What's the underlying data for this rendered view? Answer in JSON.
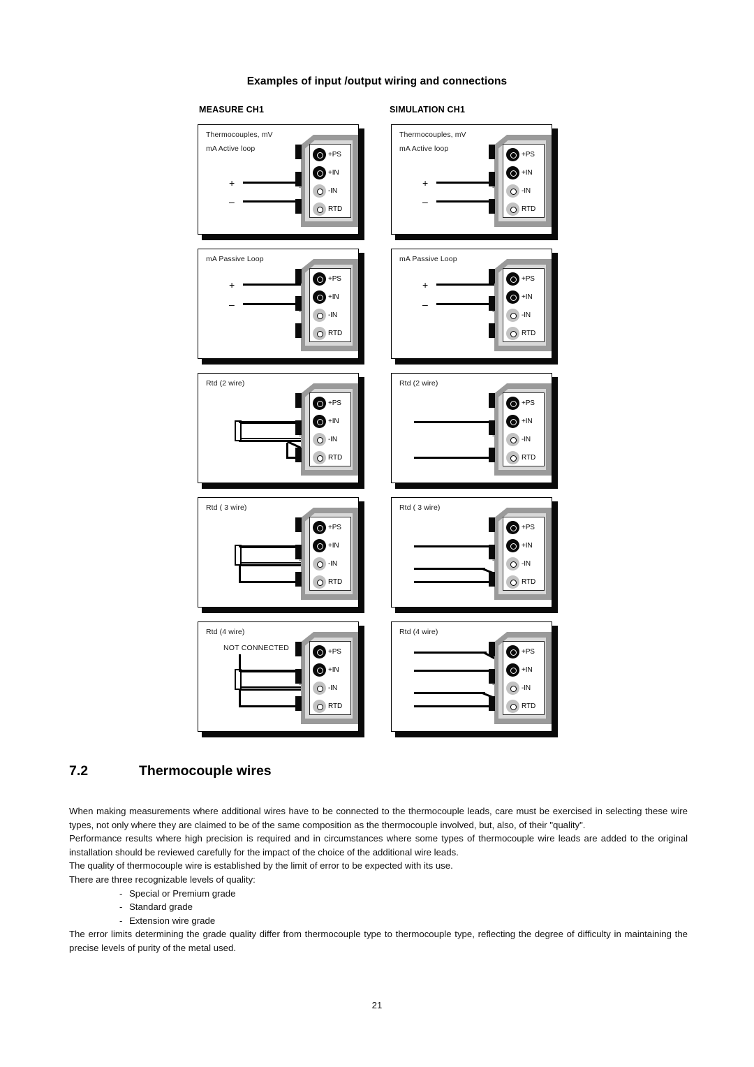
{
  "figure": {
    "title": "Examples of input /output wiring and connections",
    "columns": [
      {
        "id": "measure",
        "header": "MEASURE CH1"
      },
      {
        "id": "simulation",
        "header": "SIMULATION CH1"
      }
    ],
    "terminal_labels": [
      "+PS",
      "+IN",
      "-IN",
      "RTD"
    ],
    "terminal_states": [
      "dark",
      "dark",
      "light",
      "light"
    ],
    "dash_mark": "-",
    "rows": [
      {
        "caption_line1": "Thermocouples, mV",
        "caption_line2": "mA Active loop",
        "measure": {
          "caption_line1": "Thermocouples, mV",
          "caption_line2": "mA Active loop",
          "plus_sign": "+",
          "minus_sign": "–",
          "connected_terminals": [
            "+IN",
            "-IN"
          ],
          "not_connected_label": ""
        },
        "simulation": {
          "caption_line1": "Thermocouples, mV",
          "caption_line2": "mA Active loop",
          "plus_sign": "+",
          "minus_sign": "–",
          "connected_terminals": [
            "+IN",
            "-IN"
          ],
          "not_connected_label": ""
        }
      },
      {
        "caption_line1": "mA Passive Loop",
        "caption_line2": "",
        "measure": {
          "caption_line1": "mA Passive Loop",
          "caption_line2": "",
          "plus_sign": "+",
          "minus_sign": "–",
          "connected_terminals": [
            "+PS",
            "+IN"
          ],
          "not_connected_label": ""
        },
        "simulation": {
          "caption_line1": "mA Passive Loop",
          "caption_line2": "",
          "plus_sign": "+",
          "minus_sign": "–",
          "connected_terminals": [
            "+PS",
            "+IN"
          ],
          "not_connected_label": ""
        }
      },
      {
        "caption_line1": "Rtd (2 wire)",
        "caption_line2": "",
        "measure": {
          "caption_line1": "Rtd (2 wire)",
          "caption_line2": "",
          "plus_sign": "",
          "minus_sign": "",
          "connected_terminals": [
            "+IN",
            "-IN",
            "RTD"
          ],
          "not_connected_label": ""
        },
        "simulation": {
          "caption_line1": "Rtd (2 wire)",
          "caption_line2": "",
          "plus_sign": "",
          "minus_sign": "",
          "connected_terminals": [
            "+IN",
            "RTD"
          ],
          "not_connected_label": ""
        }
      },
      {
        "caption_line1": "Rtd ( 3 wire)",
        "caption_line2": "",
        "measure": {
          "caption_line1": "Rtd ( 3 wire)",
          "caption_line2": "",
          "plus_sign": "",
          "minus_sign": "",
          "connected_terminals": [
            "+IN",
            "-IN",
            "RTD"
          ],
          "not_connected_label": ""
        },
        "simulation": {
          "caption_line1": "Rtd ( 3 wire)",
          "caption_line2": "",
          "plus_sign": "",
          "minus_sign": "",
          "connected_terminals": [
            "+IN",
            "RTD",
            "RTD"
          ],
          "not_connected_label": ""
        }
      },
      {
        "caption_line1": "Rtd (4 wire)",
        "caption_line2": "",
        "measure": {
          "caption_line1": "Rtd (4 wire)",
          "caption_line2": "",
          "plus_sign": "",
          "minus_sign": "",
          "connected_terminals": [
            "+IN",
            "-IN",
            "RTD"
          ],
          "not_connected_label": "NOT CONNECTED"
        },
        "simulation": {
          "caption_line1": "Rtd (4 wire)",
          "caption_line2": "",
          "plus_sign": "",
          "minus_sign": "",
          "connected_terminals": [
            "+IN",
            "+IN",
            "RTD",
            "RTD"
          ],
          "not_connected_label": ""
        }
      }
    ]
  },
  "section": {
    "number": "7.2",
    "title": "Thermocouple wires",
    "paragraphs": [
      "When making measurements where additional wires have to be connected to the thermocouple leads, care must be exercised in selecting these wire types, not only where they are claimed to be of the same composition as the thermocouple involved, but, also, of their \"quality\".",
      "Performance results where high precision is required and in circumstances where some types of thermocouple wire leads are added to the original installation should be reviewed carefully for the impact of the choice of the additional wire leads.",
      "The quality of thermocouple wire is established by the limit of error to be expected with its use.",
      "There are three recognizable levels of quality:"
    ],
    "list_bullet": "-",
    "list_items": [
      "Special or Premium grade",
      "Standard grade",
      "Extension wire grade"
    ],
    "closing_paragraph": "The error limits determining the grade quality differ from thermocouple type to thermocouple type, reflecting the degree of difficulty in maintaining the precise levels of purity of the metal used."
  },
  "footer": {
    "page_number": "21"
  }
}
